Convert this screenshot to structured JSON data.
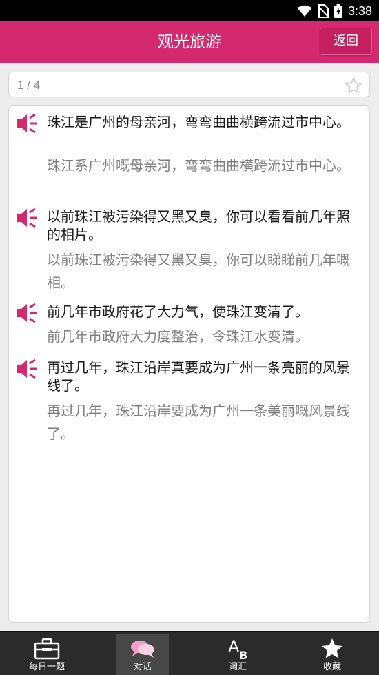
{
  "status_bar": {
    "time": "3:38"
  },
  "app_bar": {
    "title": "观光旅游",
    "back_label": "返回"
  },
  "pager": {
    "counter": "1 / 4"
  },
  "sentences": [
    {
      "mandarin": "珠江是广州的母亲河，弯弯曲曲横跨流过市中心。",
      "cantonese": "珠江系广州嘅母亲河，弯弯曲曲横跨流过市中心。"
    },
    {
      "mandarin": "以前珠江被污染得又黑又臭，你可以看看前几年照的相片。",
      "cantonese": "以前珠江被污染得又黑又臭，你可以睇睇前几年嘅相。"
    },
    {
      "mandarin": "前几年市政府花了大力气，使珠江变清了。",
      "cantonese": "前几年市政府大力度整治，令珠江水变清。"
    },
    {
      "mandarin": "再过几年，珠江沿岸真要成为广州一条亮丽的风景线了。",
      "cantonese": "再过几年，珠江沿岸要成为广州一条美丽嘅风景线了。"
    }
  ],
  "bottom_nav": [
    {
      "label": "每日一题",
      "icon": "briefcase-icon"
    },
    {
      "label": "对话",
      "icon": "chat-bubbles-icon"
    },
    {
      "label": "词汇",
      "icon": "ab-letters-icon"
    },
    {
      "label": "收藏",
      "icon": "star-icon"
    }
  ],
  "colors": {
    "accent": "#d5296f",
    "speaker": "#d5296f",
    "nav_bg": "#2b2b2b"
  }
}
